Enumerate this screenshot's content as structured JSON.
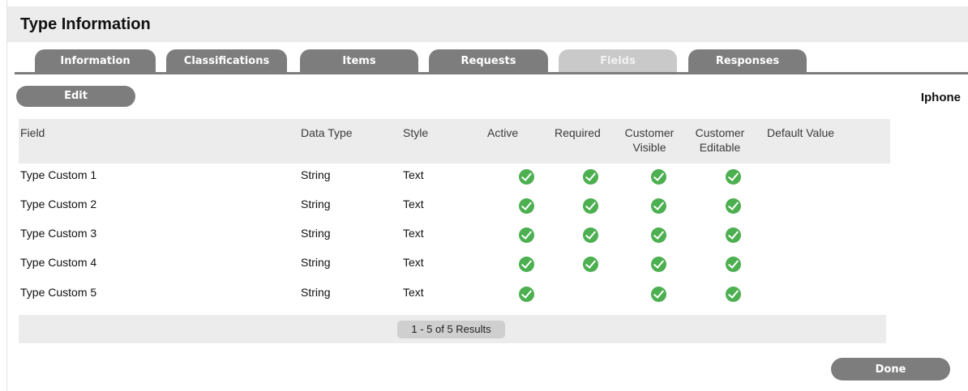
{
  "page": {
    "title": "Type Information",
    "side_label": "Iphone"
  },
  "tabs": [
    {
      "label": "Information",
      "active": false
    },
    {
      "label": "Classifications",
      "active": false
    },
    {
      "label": "Items",
      "active": false
    },
    {
      "label": "Requests",
      "active": false
    },
    {
      "label": "Fields",
      "active": true
    },
    {
      "label": "Responses",
      "active": false
    }
  ],
  "toolbar": {
    "edit_label": "Edit"
  },
  "table": {
    "headers": {
      "field": "Field",
      "data_type": "Data Type",
      "style": "Style",
      "active": "Active",
      "required": "Required",
      "customer_visible_1": "Customer",
      "customer_visible_2": "Visible",
      "customer_editable_1": "Customer",
      "customer_editable_2": "Editable",
      "default_value": "Default Value"
    },
    "rows": [
      {
        "field": "Type Custom 1",
        "data_type": "String",
        "style": "Text",
        "active": true,
        "required": true,
        "customer_visible": true,
        "customer_editable": true,
        "default_value": ""
      },
      {
        "field": "Type Custom 2",
        "data_type": "String",
        "style": "Text",
        "active": true,
        "required": true,
        "customer_visible": true,
        "customer_editable": true,
        "default_value": ""
      },
      {
        "field": "Type Custom 3",
        "data_type": "String",
        "style": "Text",
        "active": true,
        "required": true,
        "customer_visible": true,
        "customer_editable": true,
        "default_value": ""
      },
      {
        "field": "Type Custom 4",
        "data_type": "String",
        "style": "Text",
        "active": true,
        "required": true,
        "customer_visible": true,
        "customer_editable": true,
        "default_value": ""
      },
      {
        "field": "Type Custom 5",
        "data_type": "String",
        "style": "Text",
        "active": true,
        "required": false,
        "customer_visible": true,
        "customer_editable": true,
        "default_value": ""
      }
    ]
  },
  "pagination": {
    "results_text": "1 - 5 of 5 Results"
  },
  "footer": {
    "done_label": "Done"
  },
  "colors": {
    "button_gray": "#7d7d7d",
    "active_tab": "#c9c9c9",
    "check_green": "#4caf50",
    "panel_gray": "#ececec"
  }
}
